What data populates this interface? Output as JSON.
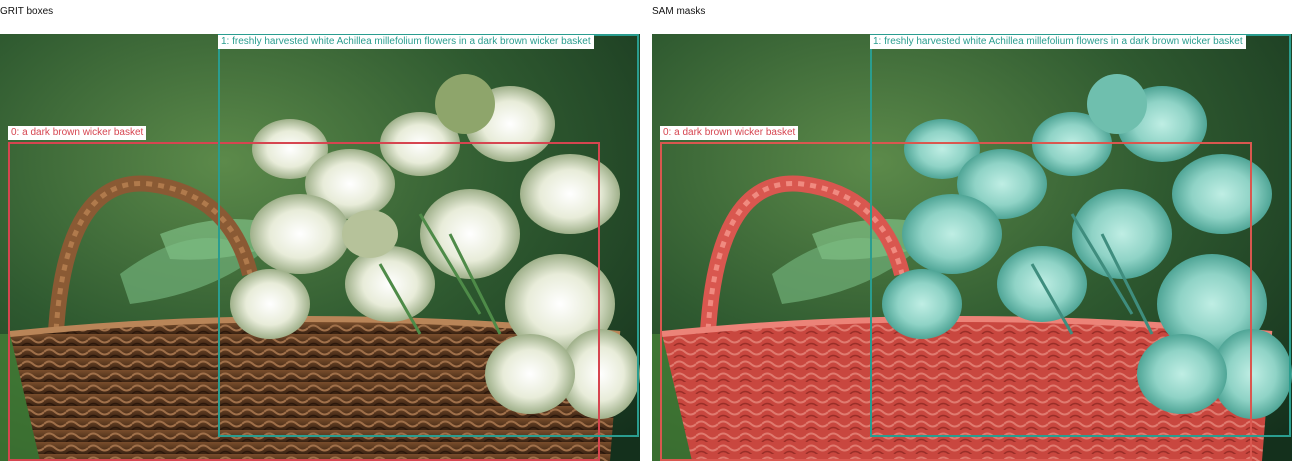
{
  "panels": {
    "left": {
      "title": "GRIT boxes"
    },
    "right": {
      "title": "SAM masks"
    }
  },
  "annotations": [
    {
      "label": "0: a dark brown wicker basket",
      "color": "#d64550"
    },
    {
      "label": "1: freshly harvested white Achillea millefolium flowers in a dark brown wicker basket",
      "color": "#2a9d8f"
    }
  ],
  "colors": {
    "basket_mask": "#d9574f",
    "flowers_mask": "#8fd3c6"
  }
}
